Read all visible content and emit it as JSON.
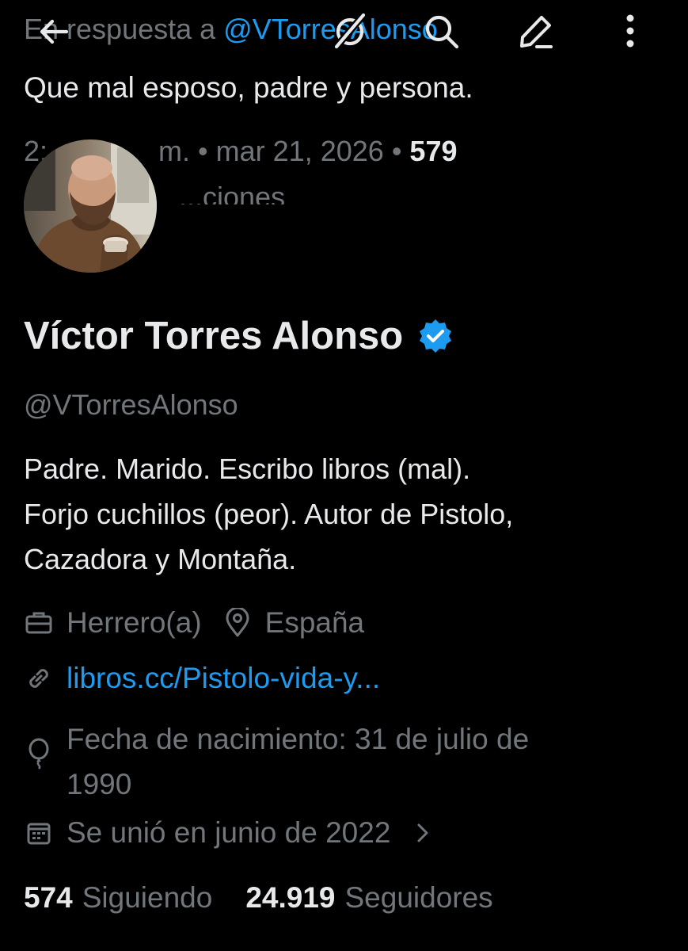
{
  "reply_context": {
    "prefix": "En respuesta a",
    "mention": "@VTorresAlonso"
  },
  "tweet": {
    "text": "Que mal esposo, padre y persona.",
    "time_partial": "2:",
    "time_suffix": "m.",
    "date": "mar 21, 2026",
    "count": "579",
    "count_label_partial": "...ciones"
  },
  "toolbar": {
    "icons": [
      "back-arrow-icon",
      "grok-icon",
      "search-icon",
      "compose-icon",
      "more-vertical-icon"
    ]
  },
  "profile": {
    "display_name": "Víctor Torres Alonso",
    "handle": "@VTorresAlonso",
    "bio_lines": [
      "Padre. Marido. Escribo libros (mal).",
      "Forjo cuchillos (peor). Autor de Pistolo,",
      "Cazadora y Montaña."
    ],
    "profession": "Herrero(a)",
    "location": "España",
    "website": "libros.cc/Pistolo-vida-y...",
    "birth_line_1": "Fecha de nacimiento: 31 de julio de",
    "birth_line_2": "1990",
    "joined": "Se unió en junio de 2022",
    "following_count": "574",
    "following_label": "Siguiendo",
    "followers_count": "24.919",
    "followers_label": "Seguidores"
  },
  "colors": {
    "background": "#000000",
    "primary_text": "#e7e9ea",
    "secondary_text": "#71767b",
    "accent": "#1d9bf0"
  }
}
